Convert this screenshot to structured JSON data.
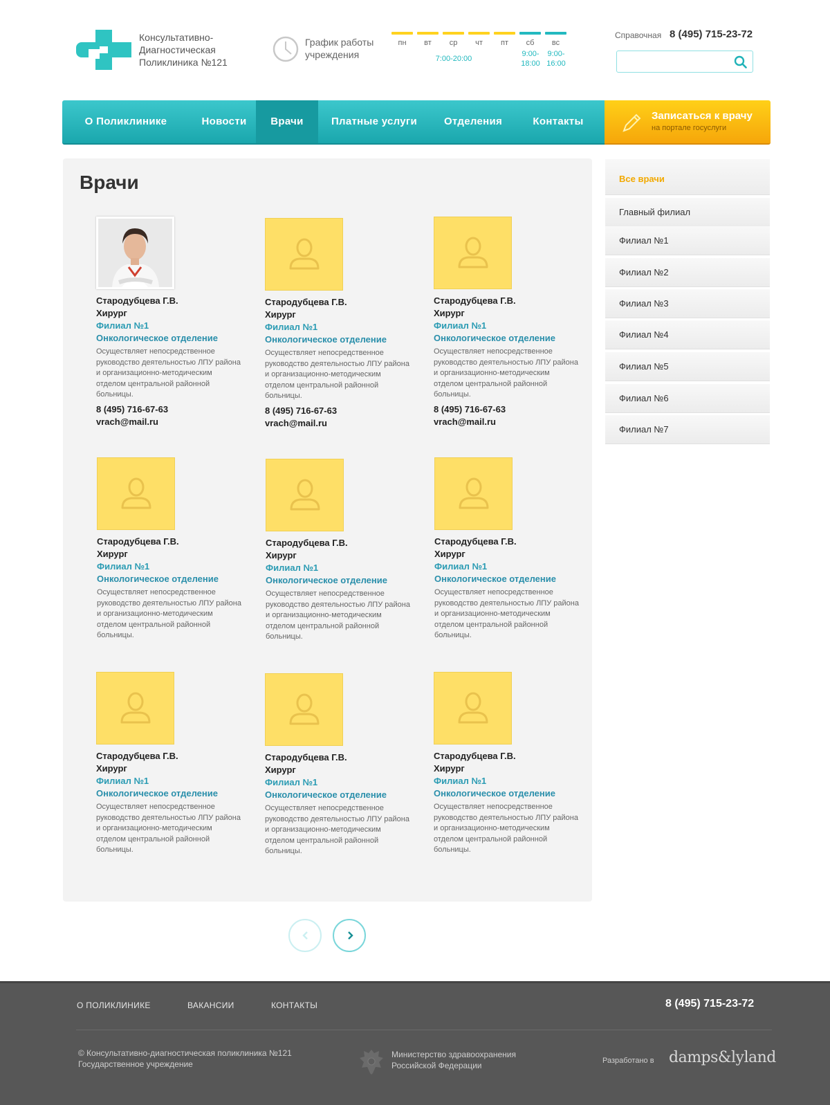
{
  "header": {
    "logo_lines": [
      "Консультативно-",
      "Диагностическая",
      "Поликлиника №121"
    ],
    "schedule_label_lines": [
      "График работы",
      "учреждения"
    ],
    "days": [
      {
        "name": "пн",
        "color": "#ffd21f"
      },
      {
        "name": "вт",
        "color": "#ffd21f"
      },
      {
        "name": "ср",
        "color": "#ffd21f"
      },
      {
        "name": "чт",
        "color": "#ffd21f"
      },
      {
        "name": "пт",
        "color": "#ffd21f"
      },
      {
        "name": "сб",
        "color": "#23b9c0"
      },
      {
        "name": "вс",
        "color": "#23b9c0"
      }
    ],
    "weekday_hours": "7:00-20:00",
    "saturday_hours": [
      "9:00-",
      "18:00"
    ],
    "sunday_hours": [
      "9:00-",
      "16:00"
    ],
    "reference_label": "Справочная",
    "reference_phone": "8 (495) 715-23-72",
    "search_placeholder": ""
  },
  "nav": {
    "items": [
      "О Поликлинике",
      "Новости",
      "Врачи",
      "Платные услуги",
      "Отделения",
      "Контакты"
    ],
    "active": "Врачи",
    "appointment_title": "Записаться к врачу",
    "appointment_sub": "на портале госуслуги"
  },
  "page_title": "Врачи",
  "doctors": [
    {
      "name": "Стародубцева Г.В.",
      "role": "Хирург",
      "branch": "Филиал №1",
      "department": "Онкологическое отделение",
      "description": "Осуществляет непосредственное руководство деятельностью ЛПУ района и организационно-методическим отделом центральной районной больницы.",
      "phone": "8 (495) 716-67-63",
      "email": "vrach@mail.ru",
      "has_photo": true
    },
    {
      "name": "Стародубцева Г.В.",
      "role": "Хирург",
      "branch": "Филиал №1",
      "department": "Онкологическое отделение",
      "description": "Осуществляет непосредственное руководство деятельностью ЛПУ района и организационно-методическим отделом центральной районной больницы.",
      "phone": "8 (495) 716-67-63",
      "email": "vrach@mail.ru",
      "has_photo": false
    },
    {
      "name": "Стародубцева Г.В.",
      "role": "Хирург",
      "branch": "Филиал №1",
      "department": "Онкологическое отделение",
      "description": "Осуществляет непосредственное руководство деятельностью ЛПУ района и организационно-методическим отделом центральной районной больницы.",
      "phone": "8 (495) 716-67-63",
      "email": "vrach@mail.ru",
      "has_photo": false
    },
    {
      "name": "Стародубцева Г.В.",
      "role": "Хирург",
      "branch": "Филиал №1",
      "department": "Онкологическое отделение",
      "description": "Осуществляет непосредственное руководство деятельностью ЛПУ района и организационно-методическим отделом центральной районной больницы.",
      "has_photo": false
    },
    {
      "name": "Стародубцева Г.В.",
      "role": "Хирург",
      "branch": "Филиал №1",
      "department": "Онкологическое отделение",
      "description": "Осуществляет непосредственное руководство деятельностью ЛПУ района и организационно-методическим отделом центральной районной больницы.",
      "has_photo": false
    },
    {
      "name": "Стародубцева Г.В.",
      "role": "Хирург",
      "branch": "Филиал №1",
      "department": "Онкологическое отделение",
      "description": "Осуществляет непосредственное руководство деятельностью ЛПУ района и организационно-методическим отделом центральной районной больницы.",
      "has_photo": false
    },
    {
      "name": "Стародубцева Г.В.",
      "role": "Хирург",
      "branch": "Филиал №1",
      "department": "Онкологическое отделение",
      "description": "Осуществляет непосредственное руководство деятельностью ЛПУ района и организационно-методическим отделом центральной районной больницы.",
      "has_photo": false
    },
    {
      "name": "Стародубцева Г.В.",
      "role": "Хирург",
      "branch": "Филиал №1",
      "department": "Онкологическое отделение",
      "description": "Осуществляет непосредственное руководство деятельностью ЛПУ района и организационно-методическим отделом центральной районной больницы.",
      "has_photo": false
    },
    {
      "name": "Стародубцева Г.В.",
      "role": "Хирург",
      "branch": "Филиал №1",
      "department": "Онкологическое отделение",
      "description": "Осуществляет непосредственное руководство деятельностью ЛПУ района и организационно-методическим отделом центральной районной больницы.",
      "has_photo": false
    }
  ],
  "sidebar": {
    "items": [
      "Все врачи",
      "Главный филиал",
      "Филиал №1",
      "Филиал №2",
      "Филиал №3",
      "Филиал №4",
      "Филиал №5",
      "Филиал №6",
      "Филиал №7"
    ],
    "active": "Все врачи"
  },
  "pager": {
    "prev_icon": "chevron-left-icon",
    "next_icon": "chevron-right-icon"
  },
  "footer": {
    "links": [
      "О ПОЛИКЛИНИКЕ",
      "ВАКАНСИИ",
      "КОНТАКТЫ"
    ],
    "phone": "8 (495) 715-23-72",
    "copyright_lines": [
      "© Консультативно-диагностическая поликлиника №121",
      "Государственное учреждение"
    ],
    "ministry_lines": [
      "Министерство здравоохранения",
      "Российской Федерации"
    ],
    "developed_label": "Разработано в",
    "developer": "damps&lyland"
  },
  "colors": {
    "teal": "#23b9c0",
    "yellow": "#ffd21f",
    "orange": "#f6a60a",
    "link_blue": "#2a9bb3"
  }
}
